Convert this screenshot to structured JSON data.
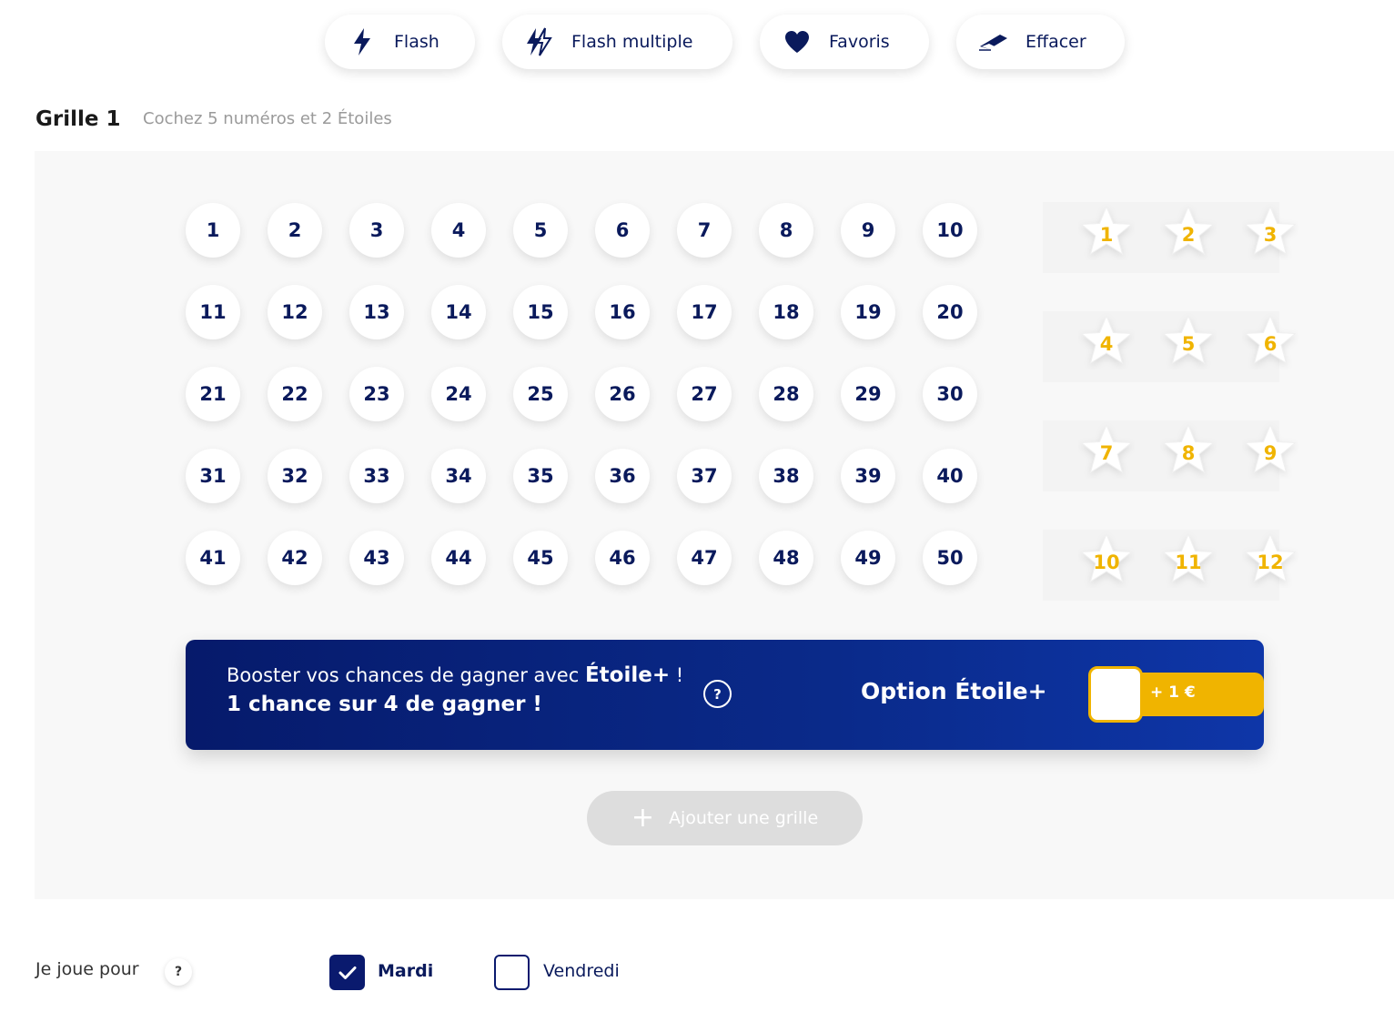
{
  "toolbar": {
    "buttons": [
      {
        "label": "Flash",
        "icon": "lightning-icon"
      },
      {
        "label": "Flash multiple",
        "icon": "double-lightning-icon"
      },
      {
        "label": "Favoris",
        "icon": "heart-icon"
      },
      {
        "label": "Effacer",
        "icon": "eraser-icon"
      }
    ]
  },
  "grid": {
    "title": "Grille 1",
    "instruction": "Cochez 5 numéros et 2 Étoiles",
    "numbers": [
      "1",
      "2",
      "3",
      "4",
      "5",
      "6",
      "7",
      "8",
      "9",
      "10",
      "11",
      "12",
      "13",
      "14",
      "15",
      "16",
      "17",
      "18",
      "19",
      "20",
      "21",
      "22",
      "23",
      "24",
      "25",
      "26",
      "27",
      "28",
      "29",
      "30",
      "31",
      "32",
      "33",
      "34",
      "35",
      "36",
      "37",
      "38",
      "39",
      "40",
      "41",
      "42",
      "43",
      "44",
      "45",
      "46",
      "47",
      "48",
      "49",
      "50"
    ],
    "stars": [
      "1",
      "2",
      "3",
      "4",
      "5",
      "6",
      "7",
      "8",
      "9",
      "10",
      "11",
      "12"
    ]
  },
  "promo": {
    "line1_prefix": "Booster vos chances de gagner avec ",
    "line1_brand": "Étoile+",
    "line1_suffix": " !",
    "line2": "1 chance sur 4 de gagner !",
    "help": "?",
    "option_label": "Option Étoile+",
    "price": "+ 1 €",
    "option_enabled": false
  },
  "add_grid": {
    "plus": "+",
    "label": "Ajouter une grille"
  },
  "play_days": {
    "label": "Je joue pour",
    "help": "?",
    "days": [
      {
        "label": "Mardi",
        "checked": true
      },
      {
        "label": "Vendredi",
        "checked": false
      }
    ]
  },
  "colors": {
    "navy": "#0a1a5c",
    "gold": "#f0b400",
    "panel_bg": "#f8f8f8",
    "promo_start": "#061a6b",
    "promo_end": "#0e36a8"
  }
}
